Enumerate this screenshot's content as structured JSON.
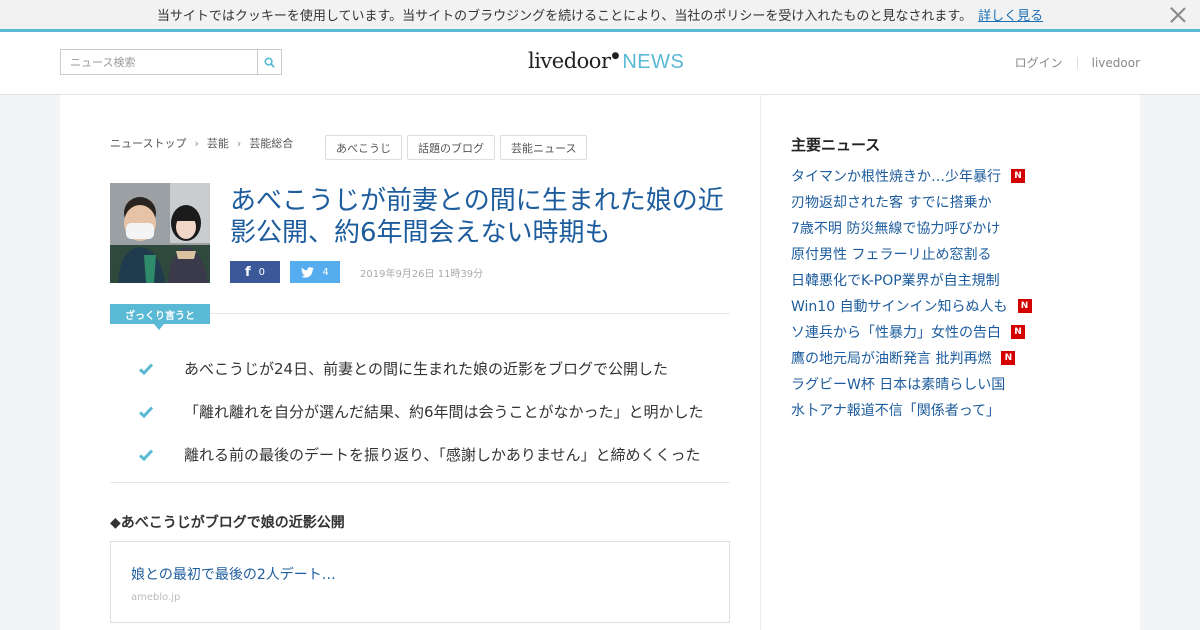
{
  "cookie": {
    "message": "当サイトではクッキーを使用しています。当サイトのブラウジングを続けることにより、当社のポリシーを受け入れたものと見なされます。",
    "link": "詳しく見る"
  },
  "header": {
    "search_placeholder": "ニュース検索",
    "logo_main": "livedoor",
    "logo_news": "NEWS",
    "nav": [
      "ログイン",
      "livedoor"
    ]
  },
  "breadcrumb": [
    "ニューストップ",
    "芸能",
    "芸能総合"
  ],
  "tags": [
    "あべこうじ",
    "話題のブログ",
    "芸能ニュース"
  ],
  "article": {
    "headline": "あべこうじが前妻との間に生まれた娘の近影公開、約6年間会えない時期も",
    "share": {
      "facebook_count": "0",
      "twitter_count": "4"
    },
    "date": "2019年9月26日 11時39分",
    "summary_label": "ざっくり言うと",
    "points": [
      "あべこうじが24日、前妻との間に生まれた娘の近影をブログで公開した",
      "「離れ離れを自分が選んだ結果、約6年間は会うことがなかった」と明かした",
      "離れる前の最後のデートを振り返り、「感謝しかありません」と締めくくった"
    ],
    "section_title": "◆あべこうじがブログで娘の近影公開",
    "link_card": {
      "title": "娘との最初で最後の2人デート…",
      "source": "ameblo.jp"
    }
  },
  "sidebar": {
    "title": "主要ニュース",
    "items": [
      {
        "text": "タイマンか根性焼きか…少年暴行",
        "new": true,
        "badge": "N"
      },
      {
        "text": "刃物返却された客 すでに搭乗か",
        "new": false
      },
      {
        "text": "7歳不明 防災無線で協力呼びかけ",
        "new": false
      },
      {
        "text": "原付男性 フェラーリ止め窓割る",
        "new": false
      },
      {
        "text": "日韓悪化でK-POP業界が自主規制",
        "new": false
      },
      {
        "text": "Win10 自動サインイン知らぬ人も",
        "new": true,
        "badge": "N"
      },
      {
        "text": "ソ連兵から「性暴力」女性の告白",
        "new": true,
        "badge": "N"
      },
      {
        "text": "鷹の地元局が油断発言 批判再燃",
        "new": true,
        "badge": "N"
      },
      {
        "text": "ラグビーW杯 日本は素晴らしい国",
        "new": false
      },
      {
        "text": "水卜アナ報道不信「関係者って」",
        "new": false
      }
    ]
  },
  "colors": {
    "accent": "#5ab9d4",
    "link": "#1d5c9d",
    "facebook": "#3b5998",
    "twitter": "#55acee",
    "new_badge": "#d40000"
  }
}
